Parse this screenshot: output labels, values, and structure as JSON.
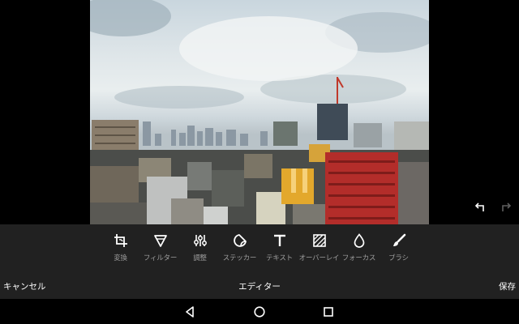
{
  "history": {
    "undo_icon": "undo-icon",
    "redo_icon": "redo-icon"
  },
  "tools": [
    {
      "id": "transform",
      "label": "変換",
      "icon": "crop-rotate-icon"
    },
    {
      "id": "filter",
      "label": "フィルター",
      "icon": "filter-icon"
    },
    {
      "id": "adjust",
      "label": "調整",
      "icon": "sliders-icon"
    },
    {
      "id": "sticker",
      "label": "ステッカー",
      "icon": "sticker-icon"
    },
    {
      "id": "text",
      "label": "テキスト",
      "icon": "text-icon"
    },
    {
      "id": "overlay",
      "label": "オーバーレイ",
      "icon": "overlay-icon"
    },
    {
      "id": "focus",
      "label": "フォーカス",
      "icon": "drop-icon"
    },
    {
      "id": "brush",
      "label": "ブラシ",
      "icon": "brush-icon"
    }
  ],
  "actionbar": {
    "cancel_label": "キャンセル",
    "title": "エディター",
    "save_label": "保存"
  },
  "navbar": {
    "back_icon": "back-icon",
    "home_icon": "home-icon",
    "recents_icon": "recents-icon"
  },
  "colors": {
    "toolbar_bg": "#212121",
    "icon_color": "#ffffff",
    "label_color": "#9e9e9e",
    "disabled": "#5f5f5f"
  }
}
